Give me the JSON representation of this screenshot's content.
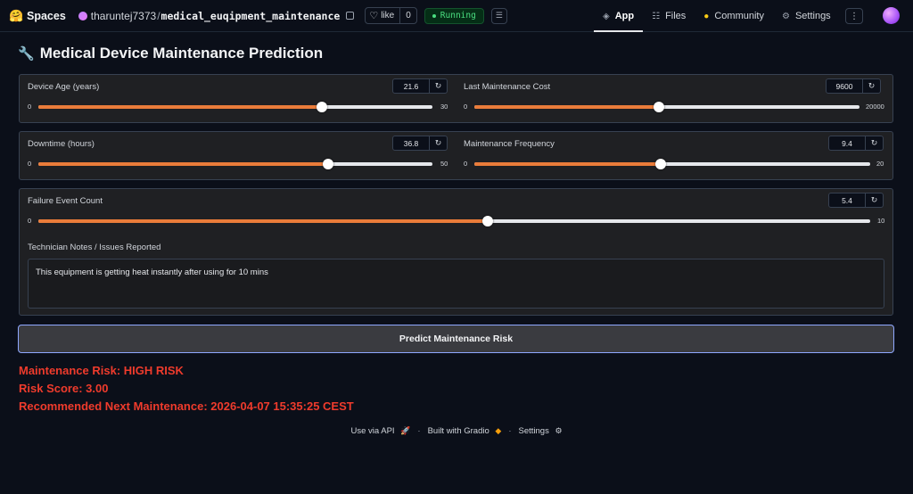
{
  "topbar": {
    "brand_emoji": "🤗",
    "brand": "Spaces",
    "owner": "tharuntej7373",
    "slash": "/",
    "repo": "medical_euqipment_maintenance",
    "like_label": "like",
    "like_count": "0",
    "status": "Running",
    "tabs": [
      {
        "label": "App",
        "icon": "cube-icon"
      },
      {
        "label": "Files",
        "icon": "files-icon"
      },
      {
        "label": "Community",
        "icon": "community-icon"
      },
      {
        "label": "Settings",
        "icon": "gear-icon"
      }
    ]
  },
  "app": {
    "title": "Medical Device Maintenance Prediction",
    "sliders": {
      "device_age": {
        "label": "Device Age (years)",
        "value": "21.6",
        "min": "0",
        "max": "30",
        "fraction": 0.72
      },
      "last_cost": {
        "label": "Last Maintenance Cost",
        "value": "9600",
        "min": "0",
        "max": "20000",
        "fraction": 0.48
      },
      "downtime": {
        "label": "Downtime (hours)",
        "value": "36.8",
        "min": "0",
        "max": "50",
        "fraction": 0.736
      },
      "frequency": {
        "label": "Maintenance Frequency",
        "value": "9.4",
        "min": "0",
        "max": "20",
        "fraction": 0.47
      },
      "failure_count": {
        "label": "Failure Event Count",
        "value": "5.4",
        "min": "0",
        "max": "10",
        "fraction": 0.54
      }
    },
    "notes_label": "Technician Notes / Issues Reported",
    "notes_value": "This equipment is getting heat instantly after using for 10 mins",
    "predict_label": "Predict Maintenance Risk",
    "results": {
      "risk": "Maintenance Risk: HIGH RISK",
      "score": "Risk Score: 3.00",
      "next": "Recommended Next Maintenance: 2026-04-07 15:35:25 CEST"
    }
  },
  "footer": {
    "api": "Use via API",
    "built": "Built with Gradio",
    "settings": "Settings"
  },
  "colors": {
    "accent": "#ea7c3a",
    "danger": "#ef3b2c",
    "status_green": "#4ade80"
  }
}
